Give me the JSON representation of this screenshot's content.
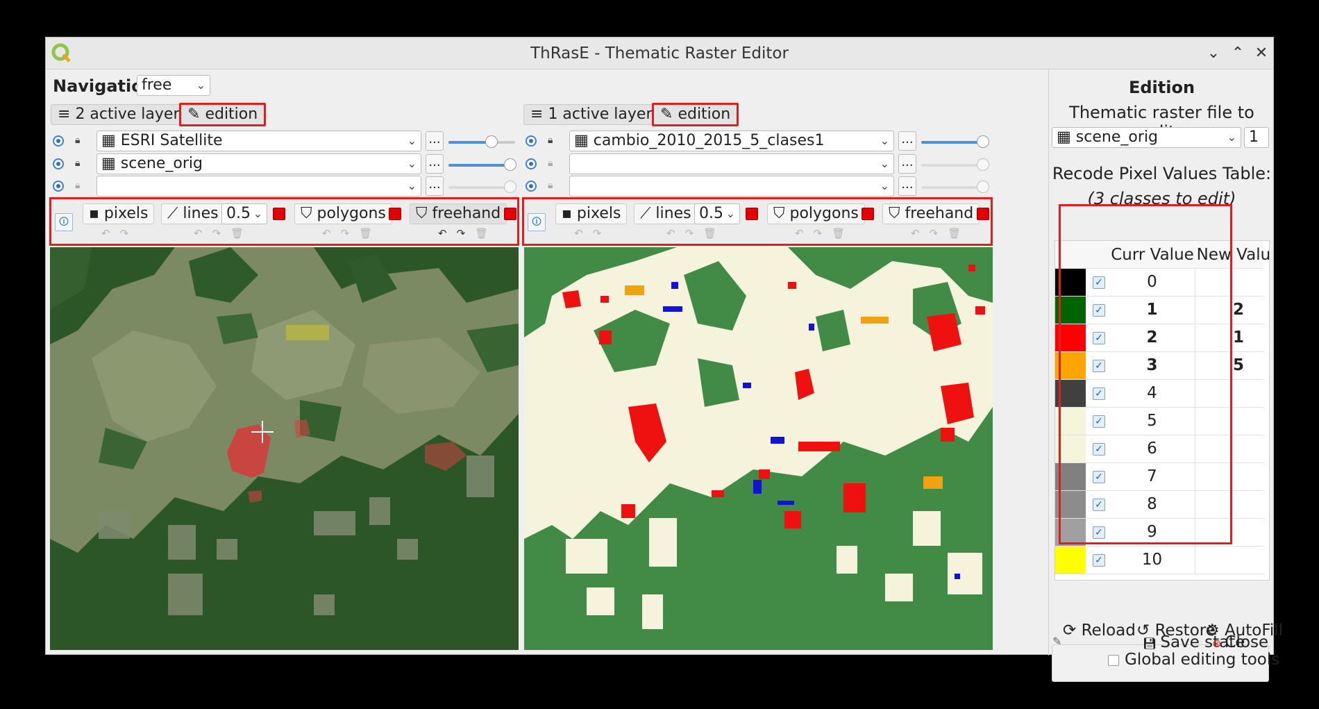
{
  "window": {
    "title": "ThRasE - Thematic Raster Editor"
  },
  "navigation": {
    "label": "Navigation",
    "mode": "free"
  },
  "left_view": {
    "active_layers_label": "2 active layers",
    "edition_label": "edition",
    "layers": [
      "ESRI Satellite",
      "scene_orig",
      ""
    ],
    "slider_levels": [
      0.62,
      0.92,
      0.92
    ],
    "tools": {
      "pixels": "pixels",
      "lines": "lines",
      "line_width": "0.5",
      "polygons": "polygons",
      "freehand": "freehand"
    }
  },
  "right_view": {
    "active_layers_label": "1 active layers",
    "edition_label": "edition",
    "layers": [
      "cambio_2010_2015_5_clases1",
      "",
      ""
    ],
    "slider_levels": [
      0.92,
      0.92,
      0.92
    ],
    "tools": {
      "pixels": "pixels",
      "lines": "lines",
      "line_width": "0.5",
      "polygons": "polygons",
      "freehand": "freehand"
    }
  },
  "edition_panel": {
    "title": "Edition",
    "file_label": "Thematic raster file to edit:",
    "file": "scene_orig",
    "band": "1",
    "table_title": "Recode Pixel Values Table:",
    "table_subtitle": "(3 classes to edit)",
    "col_curr": "Curr Value",
    "col_new": "New Value",
    "rows": [
      {
        "color": "#000000",
        "curr": "0",
        "new": ""
      },
      {
        "color": "#006400",
        "curr": "1",
        "new": "2"
      },
      {
        "color": "#ff0000",
        "curr": "2",
        "new": "1"
      },
      {
        "color": "#ffa500",
        "curr": "3",
        "new": "5"
      },
      {
        "color": "#404040",
        "curr": "4",
        "new": ""
      },
      {
        "color": "#f5f5dc",
        "curr": "5",
        "new": ""
      },
      {
        "color": "#f5f5dc",
        "curr": "6",
        "new": ""
      },
      {
        "color": "#808080",
        "curr": "7",
        "new": ""
      },
      {
        "color": "#8c8c8c",
        "curr": "8",
        "new": ""
      },
      {
        "color": "#a0a0a0",
        "curr": "9",
        "new": ""
      },
      {
        "color": "#ffff00",
        "curr": "10",
        "new": ""
      }
    ],
    "reload": "Reload",
    "restore": "Restore",
    "autofill": "AutoFill",
    "global_tools": "Global editing tools",
    "save_state": "Save state",
    "close": "Close"
  }
}
